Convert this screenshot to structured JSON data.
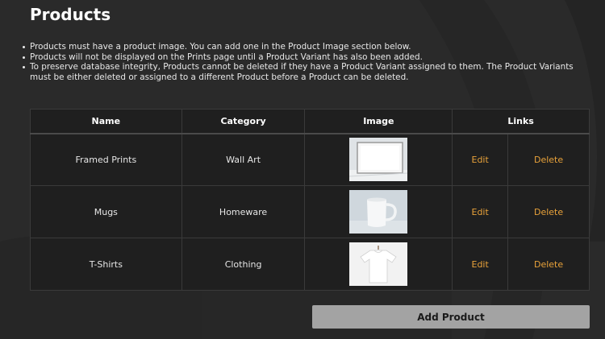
{
  "page": {
    "title": "Products"
  },
  "notes": [
    "Products must have a product image. You can add one in the Product Image section below.",
    "Products will not be displayed on the Prints page until a Product Variant has also been added.",
    "To preserve database integrity, Products cannot be deleted if they have a Product Variant assigned to them. The Product Variants must be either deleted or assigned to a different Product before a Product can be deleted."
  ],
  "table": {
    "headers": {
      "name": "Name",
      "category": "Category",
      "image": "Image",
      "links": "Links"
    },
    "rows": [
      {
        "name": "Framed Prints",
        "category": "Wall Art",
        "image_icon": "framed-print-image",
        "edit": "Edit",
        "delete": "Delete"
      },
      {
        "name": "Mugs",
        "category": "Homeware",
        "image_icon": "mug-image",
        "edit": "Edit",
        "delete": "Delete"
      },
      {
        "name": "T-Shirts",
        "category": "Clothing",
        "image_icon": "tshirt-image",
        "edit": "Edit",
        "delete": "Delete"
      }
    ]
  },
  "actions": {
    "add_product": "Add Product"
  },
  "colors": {
    "background": "#2a2a2a",
    "table_bg": "#1f1f1f",
    "link": "#e8a23a",
    "button_bg": "#a3a3a3"
  }
}
